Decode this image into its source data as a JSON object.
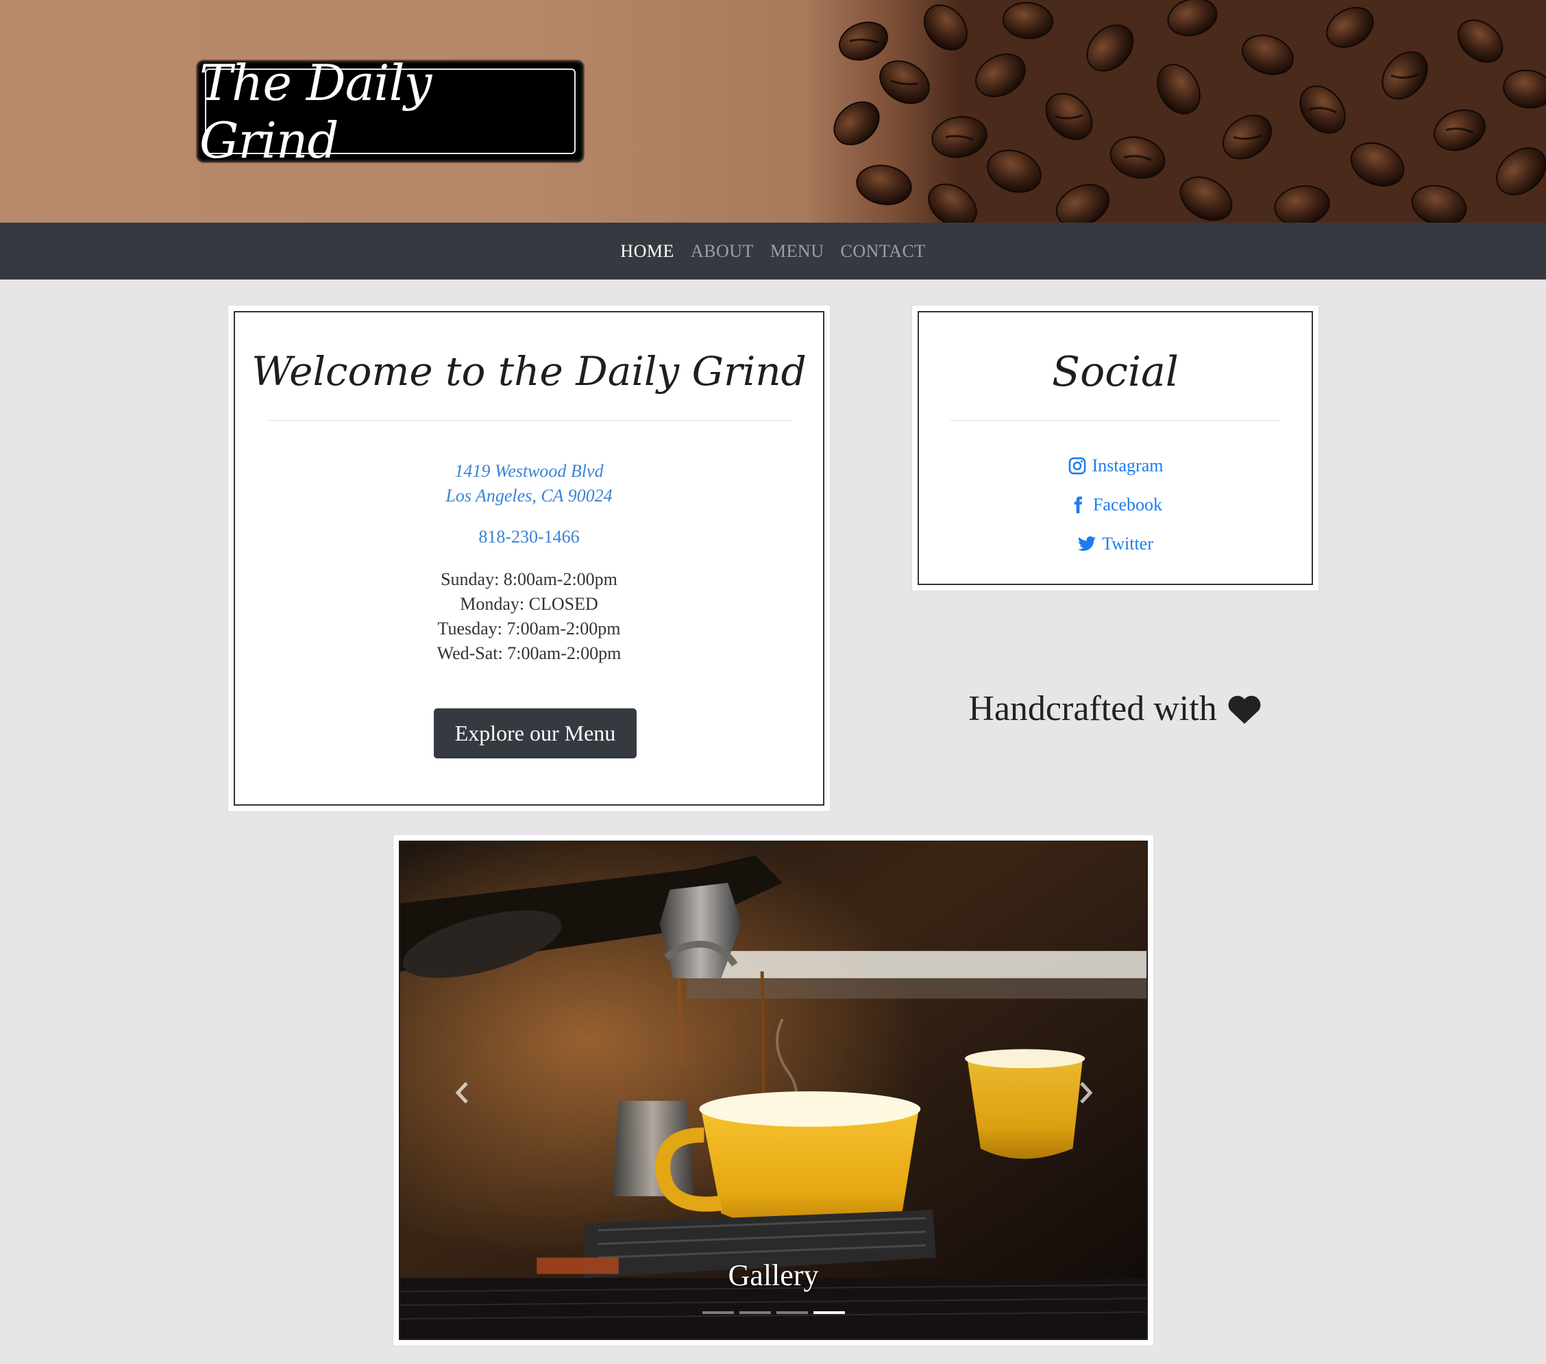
{
  "brand": {
    "logo_text": "The Daily Grind"
  },
  "nav": {
    "items": [
      {
        "label": "HOME",
        "active": true
      },
      {
        "label": "ABOUT",
        "active": false
      },
      {
        "label": "MENU",
        "active": false
      },
      {
        "label": "CONTACT",
        "active": false
      }
    ]
  },
  "welcome": {
    "title": "Welcome to the Daily Grind",
    "address_line1": "1419 Westwood Blvd",
    "address_line2": "Los Angeles, CA 90024",
    "phone": "818-230-1466",
    "hours": [
      "Sunday: 8:00am-2:00pm",
      "Monday: CLOSED",
      "Tuesday: 7:00am-2:00pm",
      "Wed-Sat: 7:00am-2:00pm"
    ],
    "button_label": "Explore our Menu"
  },
  "social": {
    "title": "Social",
    "links": [
      {
        "label": "Instagram",
        "icon": "instagram-icon"
      },
      {
        "label": "Facebook",
        "icon": "facebook-icon"
      },
      {
        "label": "Twitter",
        "icon": "twitter-icon"
      }
    ]
  },
  "tagline": {
    "text": "Handcrafted with",
    "icon": "heart-icon"
  },
  "gallery": {
    "caption": "Gallery",
    "slide_count": 4,
    "active_slide": 4
  },
  "colors": {
    "nav_bg": "#343a40",
    "link": "#1c7cf0",
    "page_bg": "#e7e5e6",
    "button_bg": "#343a40"
  }
}
